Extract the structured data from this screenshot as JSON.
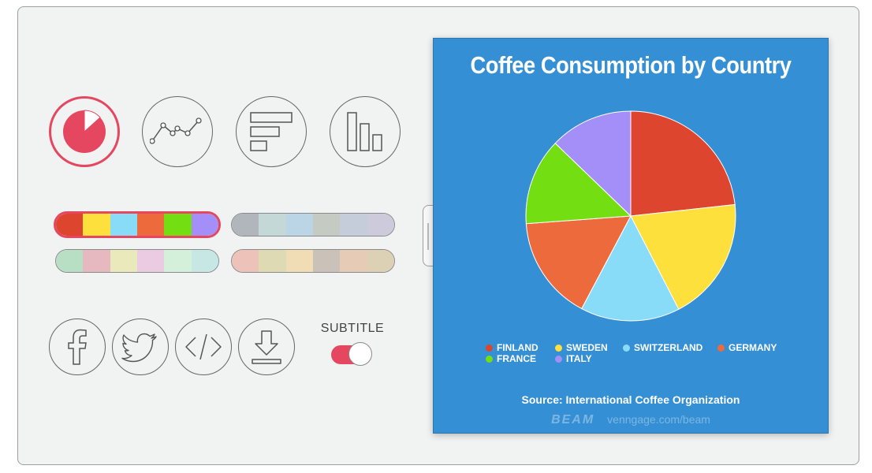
{
  "chart_types": [
    {
      "name": "pie-chart",
      "selected": true
    },
    {
      "name": "line-chart",
      "selected": false
    },
    {
      "name": "horizontal-bar-chart",
      "selected": false
    },
    {
      "name": "column-chart",
      "selected": false
    }
  ],
  "palettes": [
    {
      "selected": true,
      "colors": [
        "#dd452f",
        "#fde03b",
        "#88dcf8",
        "#ec6a3c",
        "#73df12",
        "#a38ff7"
      ]
    },
    {
      "selected": false,
      "colors": [
        "#b0b6bb",
        "#c4d8d7",
        "#bcd5e6",
        "#c5cbc2",
        "#c5cddb",
        "#cccadb"
      ]
    },
    {
      "selected": false,
      "colors": [
        "#b8dfc4",
        "#e6b9c1",
        "#e9e9bb",
        "#ebcbe2",
        "#d4f0da",
        "#c6e7e3"
      ]
    },
    {
      "selected": false,
      "colors": [
        "#ecc2b9",
        "#dedbb4",
        "#f0dcb5",
        "#cac1b8",
        "#e6cbb6",
        "#ddd1b5"
      ]
    }
  ],
  "share_icons": [
    "facebook-icon",
    "twitter-icon",
    "embed-code-icon",
    "download-icon"
  ],
  "controls": {
    "subtitle_label": "SUBTITLE",
    "subtitle_toggle_on": true
  },
  "chart_data": {
    "type": "pie",
    "title": "Coffee Consumption by Country",
    "categories": [
      "FINLAND",
      "SWEDEN",
      "SWITZERLAND",
      "GERMANY",
      "FRANCE",
      "ITALY"
    ],
    "values": [
      12,
      9.9,
      7.9,
      8.3,
      6.9,
      6.6
    ],
    "colors": [
      "#dd452f",
      "#fde03b",
      "#88dcf8",
      "#ec6a3c",
      "#73df12",
      "#a38ff7"
    ],
    "legend": "bottom",
    "source": "Source: International Coffee Organization"
  },
  "watermark": {
    "brand": "BEAM",
    "url": "venngage.com/beam"
  }
}
